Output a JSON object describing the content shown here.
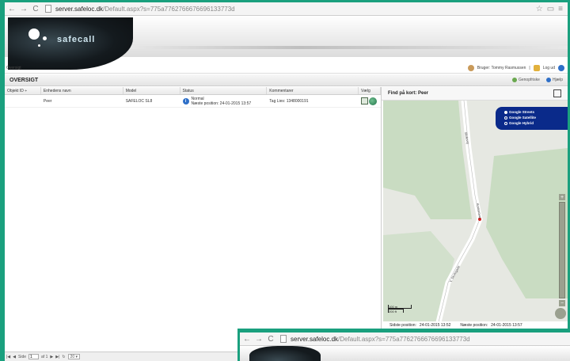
{
  "browser": {
    "url_host": "server.safeloc.dk",
    "url_rest": "/Default.aspx?s=775a7762766676696133773d"
  },
  "app": {
    "logo_text": "safecall"
  },
  "user_bar": {
    "crumb": "Oversigt",
    "user_label": "Bruger: Tommy Rasmussen",
    "separator": "|",
    "logout": "Log ud"
  },
  "section": {
    "title": "OVERSIGT",
    "refresh": "Genopfriske",
    "help": "Hjælp"
  },
  "table": {
    "headers": [
      "Objekt ID",
      "Enhedens navn",
      "Model",
      "Status",
      "Kommentarer",
      "Vælg"
    ],
    "sort_indicator": "÷",
    "rows": [
      {
        "id": "",
        "name": "Peer",
        "model": "SAFELOC SL8",
        "status_line1": "Normal",
        "status_line2": "Næste position: 24-01-2015 13:57",
        "comment": "Tag Lies: 1348000191"
      }
    ]
  },
  "pager": {
    "page_label": "Side",
    "page_value": "1",
    "of_label": "af 1",
    "page_size": "20"
  },
  "map": {
    "title": "Find på kort: Peer",
    "types": [
      "Google Streets",
      "Google Satellite",
      "Google Hybrid"
    ],
    "selected_type": "Google Streets",
    "road_label_1": "Skolevej",
    "road_label_2": "Kornumvej",
    "road_label_3": "V. Skolegade",
    "scale_top": "100 m",
    "scale_bottom": "200 ft",
    "last_position_label": "Sidste position:",
    "last_position_value": "24-01-2015 13:52",
    "next_position_label": "Næste position:",
    "next_position_value": "24-01-2015 13:57"
  },
  "win2": {
    "url_host": "server.safeloc.dk",
    "url_rest": "/Default.aspx?s=775a7762766676696133773d"
  },
  "colors": {
    "frame": "#1aa07e",
    "map_type_bg": "#0a2a8a",
    "road": "#ffffff",
    "map_green": "#c9dcc2"
  }
}
